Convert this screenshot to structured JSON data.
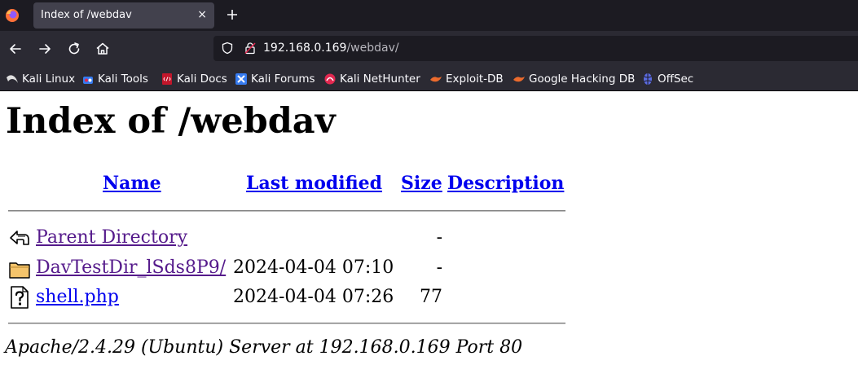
{
  "browser": {
    "tab": {
      "title": "Index of /webdav",
      "close_glyph": "×"
    },
    "new_tab_icon": "plus-icon",
    "url": {
      "host": "192.168.0.169",
      "path": "/webdav/"
    },
    "bookmarks": [
      {
        "label": "Kali Linux",
        "icon": "kali-dragon-icon"
      },
      {
        "label": "Kali Tools",
        "icon": "kali-tools-icon"
      },
      {
        "label": "Kali Docs",
        "icon": "kali-docs-icon"
      },
      {
        "label": "Kali Forums",
        "icon": "kali-forums-icon"
      },
      {
        "label": "Kali NetHunter",
        "icon": "nethunter-icon"
      },
      {
        "label": "Exploit-DB",
        "icon": "exploit-db-icon"
      },
      {
        "label": "Google Hacking DB",
        "icon": "ghdb-icon"
      },
      {
        "label": "OffSec",
        "icon": "offsec-icon"
      }
    ]
  },
  "page": {
    "title": "Index of /webdav",
    "columns": {
      "name": "Name",
      "modified": "Last modified",
      "size": "Size",
      "description": "Description"
    },
    "rows": [
      {
        "name": "Parent Directory",
        "modified": "",
        "size": "-",
        "icon": "back-icon"
      },
      {
        "name": "DavTestDir_lSds8P9/",
        "modified": "2024-04-04 07:10",
        "size": "-",
        "icon": "folder-icon"
      },
      {
        "name": "shell.php",
        "modified": "2024-04-04 07:26",
        "size": "77",
        "icon": "unknown-file-icon"
      }
    ],
    "address": "Apache/2.4.29 (Ubuntu) Server at 192.168.0.169 Port 80"
  },
  "colors": {
    "chrome_dark": "#1c1b22",
    "chrome_mid": "#2b2a33",
    "tab_active": "#42414d",
    "link": "#0000ee",
    "visited_link": "#551a8b"
  }
}
